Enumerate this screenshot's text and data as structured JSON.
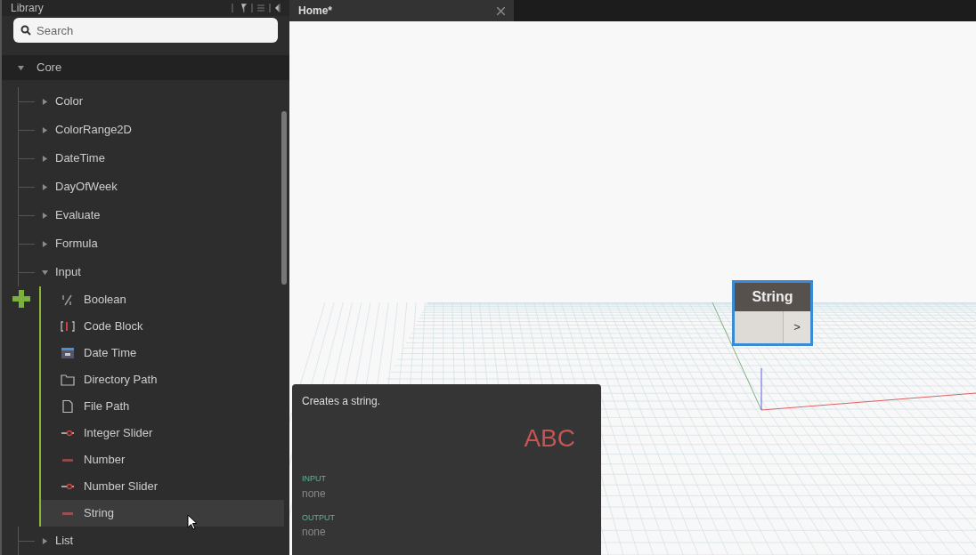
{
  "library": {
    "title": "Library",
    "search": {
      "placeholder": "Search"
    },
    "sections": [
      {
        "label": "Core",
        "expanded": true,
        "children": [
          {
            "label": "Color",
            "expanded": false
          },
          {
            "label": "ColorRange2D",
            "expanded": false
          },
          {
            "label": "DateTime",
            "expanded": false
          },
          {
            "label": "DayOfWeek",
            "expanded": false
          },
          {
            "label": "Evaluate",
            "expanded": false
          },
          {
            "label": "Formula",
            "expanded": false
          },
          {
            "label": "Input",
            "expanded": true,
            "children": [
              {
                "label": "Boolean",
                "kind": "boolean",
                "selected": false
              },
              {
                "label": "Code Block",
                "kind": "code",
                "selected": false
              },
              {
                "label": "Date Time",
                "kind": "calendar",
                "selected": false
              },
              {
                "label": "Directory Path",
                "kind": "folder",
                "selected": false
              },
              {
                "label": "File Path",
                "kind": "file",
                "selected": false
              },
              {
                "label": "Integer Slider",
                "kind": "slider",
                "selected": false
              },
              {
                "label": "Number",
                "kind": "number",
                "selected": false
              },
              {
                "label": "Number Slider",
                "kind": "slider",
                "selected": false
              },
              {
                "label": "String",
                "kind": "string",
                "selected": true
              }
            ]
          },
          {
            "label": "List",
            "expanded": false
          }
        ]
      }
    ]
  },
  "tabs": [
    {
      "label": "Home*",
      "selected": true
    }
  ],
  "node": {
    "title": "String",
    "output": ">"
  },
  "tooltip": {
    "description": "Creates a string.",
    "icon_text": "ABC",
    "input_label": "INPUT",
    "input_value": "none",
    "output_label": "OUTPUT",
    "output_value": "none"
  }
}
